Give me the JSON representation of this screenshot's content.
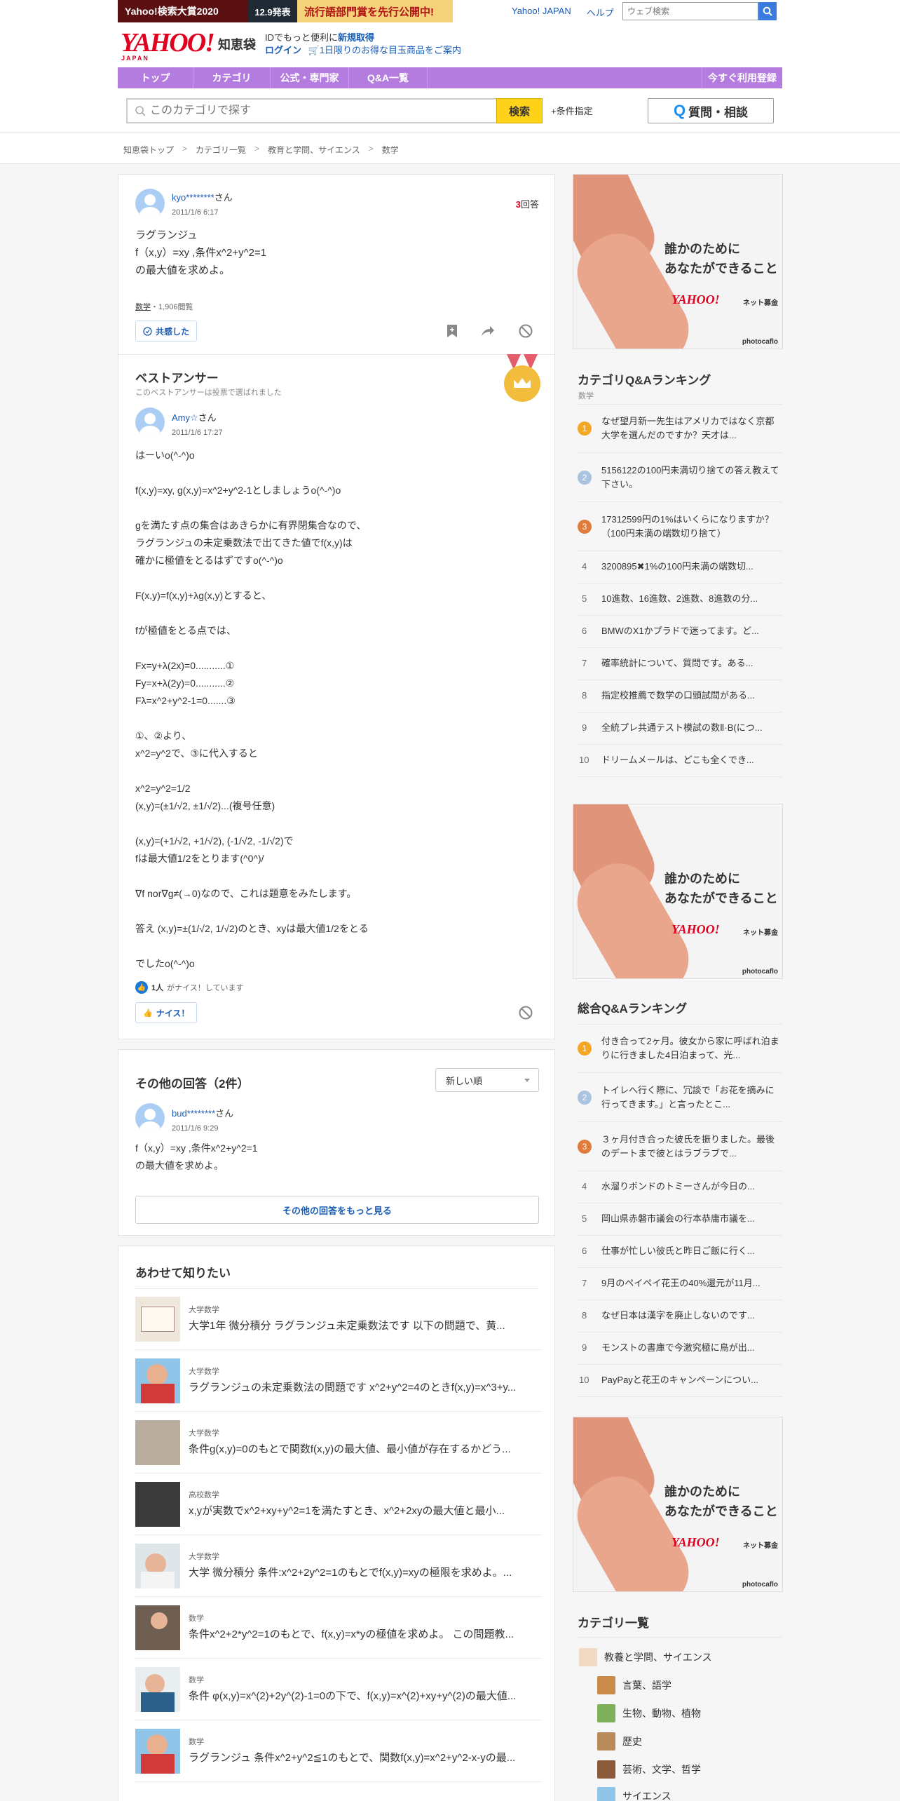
{
  "header": {
    "promo": {
      "p1": "Yahoo!検索大賞2020",
      "p2": "12.9発表",
      "p3": "流行語部門賞を先行公開中!"
    },
    "yahoo_japan": "Yahoo! JAPAN",
    "help": "ヘルプ",
    "web_search_placeholder": "ウェブ検索",
    "logo": "YAHOO!",
    "logo_sub": "JAPAN",
    "service_name": "知恵袋",
    "account_line1_a": "IDでもっと便利に",
    "account_line1_b": "新規取得",
    "account_line2_a": "ログイン",
    "account_line2_b": "1日限りのお得な目玉商品をご案内"
  },
  "nav": {
    "items": [
      "トップ",
      "カテゴリ",
      "公式・専門家",
      "Q&A一覧"
    ],
    "register": "今すぐ利用登録"
  },
  "search": {
    "placeholder": "このカテゴリで探す",
    "button": "検索",
    "condition": "条件指定",
    "ask": "質問・相談",
    "ask_q": "Q"
  },
  "breadcrumb": [
    "知恵袋トップ",
    "カテゴリ一覧",
    "教育と学問、サイエンス",
    "数学"
  ],
  "question": {
    "user": "kyo********",
    "honorific": "さん",
    "date": "2011/1/6 6:17",
    "answers_count": "3",
    "answers_label": "回答",
    "body": "ラグランジュ\nf（x,y）=xy ,条件x^2+y^2=1\nの最大値を求めよ。",
    "category": "数学",
    "views": "・1,906閲覧",
    "empathy": "共感した"
  },
  "best_answer": {
    "title": "ベストアンサー",
    "subtitle": "このベストアンサーは投票で選ばれました",
    "user": "Amy☆",
    "honorific": "さん",
    "date": "2011/1/6 17:27",
    "body": "はーいo(^-^)o\n\nf(x,y)=xy, g(x,y)=x^2+y^2-1としましょうo(^-^)o\n\ngを満たす点の集合はあきらかに有界閉集合なので、\nラグランジュの未定乗数法で出てきた値でf(x,y)は\n確かに極値をとるはずですo(^-^)o\n\nF(x,y)=f(x,y)+λg(x,y)とすると、\n\nfが極値をとる点では、\n\nFx=y+λ(2x)=0...........①\nFy=x+λ(2y)=0...........②\nFλ=x^2+y^2-1=0.......③\n\n①、②より、\nx^2=y^2で、③に代入すると\n\nx^2=y^2=1/2\n(x,y)=(±1/√2, ±1/√2)...(複号任意)\n\n(x,y)=(+1/√2, +1/√2), (-1/√2, -1/√2)で\nfは最大値1/2をとります(^0^)/\n\n∇f nor∇g≠(→0)なので、これは題意をみたします。\n\n答え (x,y)=±(1/√2, 1/√2)のとき、xyは最大値1/2をとる\n\nでしたo(^-^)o",
    "nice_count": "1人",
    "nice_text": "がナイス！しています",
    "nice_button": "ナイス！"
  },
  "other_answers": {
    "title": "その他の回答（2件）",
    "sort": "新しい順",
    "user": "bud********",
    "honorific": "さん",
    "date": "2011/1/6 9:29",
    "body": "f（x,y）=xy ,条件x^2+y^2=1\nの最大値を求めよ。",
    "more": "その他の回答をもっと見る"
  },
  "related": {
    "title": "あわせて知りたい",
    "items": [
      {
        "cat": "大学数学",
        "title": "大学1年 微分積分 ラグランジュ未定乗数法です 以下の問題で、黄..."
      },
      {
        "cat": "大学数学",
        "title": "ラグランジュの未定乗数法の問題です x^2+y^2=4のときf(x,y)=x^3+y..."
      },
      {
        "cat": "大学数学",
        "title": "条件g(x,y)=0のもとで関数f(x,y)の最大値、最小値が存在するかどう..."
      },
      {
        "cat": "高校数学",
        "title": "x,yが実数でx^2+xy+y^2=1を満たすとき、x^2+2xyの最大値と最小..."
      },
      {
        "cat": "大学数学",
        "title": "大学 微分積分 条件:x^2+2y^2=1のもとでf(x,y)=xyの極限を求めよ。..."
      },
      {
        "cat": "数学",
        "title": "条件x^2+2*y^2=1のもとで、f(x,y)=x*yの極値を求めよ。 この問題教..."
      },
      {
        "cat": "数学",
        "title": "条件 φ(x,y)=x^(2)+2y^(2)-1=0の下で、f(x,y)=x^(2)+xy+y^(2)の最大値..."
      },
      {
        "cat": "数学",
        "title": "ラグランジュ 条件x^2+y^2≦1のもとで、関数f(x,y)=x^2+y^2-x-yの最..."
      }
    ]
  },
  "ad": {
    "line1": "誰かのために",
    "line2": "あなたができること",
    "brand": "YAHOO!",
    "brand2": "ネット募金",
    "credit": "photocaflo"
  },
  "cat_ranking": {
    "title": "カテゴリQ&Aランキング",
    "sub": "数学",
    "items": [
      {
        "n": "1",
        "text": "なぜ望月新一先生はアメリカではなく京都大学を選んだのですか？天才は..."
      },
      {
        "n": "2",
        "text": "5156122の100円未満切り捨ての答え教えて下さい。"
      },
      {
        "n": "3",
        "text": "17312599円の1%はいくらになりますか？（100円未満の端数切り捨て）"
      },
      {
        "n": "4",
        "text": "3200895✖1%の100円未満の端数切..."
      },
      {
        "n": "5",
        "text": "10進数、16進数、2進数、8進数の分..."
      },
      {
        "n": "6",
        "text": "BMWのX1かプラドで迷ってます。ど..."
      },
      {
        "n": "7",
        "text": "確率統計について、質問です。ある..."
      },
      {
        "n": "8",
        "text": "指定校推薦で数学の口頭試問がある..."
      },
      {
        "n": "9",
        "text": "全統プレ共通テスト模試の数Ⅱ·B(につ..."
      },
      {
        "n": "10",
        "text": "ドリームメールは、どこも全くでき..."
      }
    ]
  },
  "total_ranking": {
    "title": "総合Q&Aランキング",
    "items": [
      {
        "n": "1",
        "text": "付き合って2ヶ月。彼女から家に呼ばれ泊まりに行きました4日泊まって、光..."
      },
      {
        "n": "2",
        "text": "トイレへ行く際に、冗談で「お花を摘みに行ってきます。」と言ったとこ..."
      },
      {
        "n": "3",
        "text": "３ヶ月付き合った彼氏を振りました。最後のデートまで彼とはラブラブで..."
      },
      {
        "n": "4",
        "text": "水溜りボンドのトミーさんが今日の..."
      },
      {
        "n": "5",
        "text": "岡山県赤磐市議会の行本恭庸市議を..."
      },
      {
        "n": "6",
        "text": "仕事が忙しい彼氏と昨日ご飯に行く..."
      },
      {
        "n": "7",
        "text": "9月のペイペイ花王の40%還元が11月..."
      },
      {
        "n": "8",
        "text": "なぜ日本は漢字を廃止しないのです..."
      },
      {
        "n": "9",
        "text": "モンストの書庫で今激究極に鳥が出..."
      },
      {
        "n": "10",
        "text": "PayPayと花王のキャンペーンについ..."
      }
    ]
  },
  "category_list": {
    "title": "カテゴリ一覧",
    "parent": "教養と学問、サイエンス",
    "children": [
      "言葉、語学",
      "生物、動物、植物",
      "歴史",
      "芸術、文学、哲学",
      "サイエンス"
    ]
  },
  "colors": {
    "accent": "#b57ce0",
    "link": "#1a5cb6",
    "rank1": "#f5a623",
    "rank2": "#a9c3e0",
    "rank3": "#e07b3c"
  }
}
